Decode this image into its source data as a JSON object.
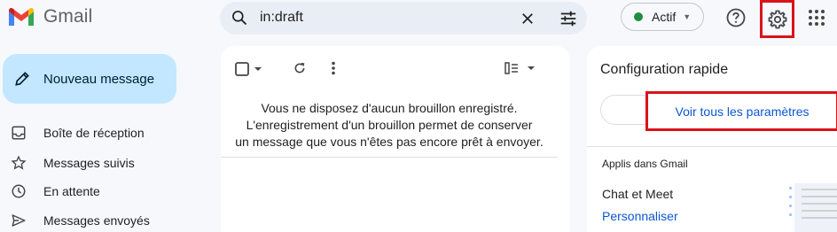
{
  "app": {
    "name": "Gmail"
  },
  "search": {
    "query": "in:draft"
  },
  "status": {
    "label": "Actif",
    "color": "#1e8e3e"
  },
  "header_icons": [
    "search-icon",
    "clear-search-icon",
    "search-options-icon",
    "help-icon",
    "settings-gear-icon",
    "apps-grid-icon"
  ],
  "compose": {
    "label": "Nouveau message"
  },
  "nav": {
    "items": [
      {
        "label": "Boîte de réception",
        "icon": "inbox-icon"
      },
      {
        "label": "Messages suivis",
        "icon": "star-icon"
      },
      {
        "label": "En attente",
        "icon": "clock-icon"
      },
      {
        "label": "Messages envoyés",
        "icon": "send-icon"
      }
    ]
  },
  "main": {
    "empty_lines": [
      "Vous ne disposez d'aucun brouillon enregistré.",
      "L'enregistrement d'un brouillon permet de conserver",
      "un message que vous n'êtes pas encore prêt à envoyer."
    ]
  },
  "quick_settings": {
    "title": "Configuration rapide",
    "see_all_label": "Voir tous les paramètres",
    "apps_section_label": "Applis dans Gmail",
    "chat_meet_label": "Chat et Meet",
    "customize_label": "Personnaliser"
  },
  "colors": {
    "accent_link": "#0b57d0",
    "compose_bg": "#c2e7ff",
    "highlight_box": "#d9131a",
    "search_bg": "#e9eef6"
  }
}
